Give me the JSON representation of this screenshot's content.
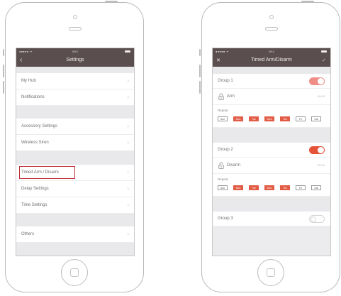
{
  "left_phone": {
    "status": {
      "signal": "●●●●● ᯤ",
      "time": "09:2"
    },
    "navbar": {
      "back_icon": "chevron-left",
      "title": "Settings"
    },
    "items": [
      {
        "label": "My Hub"
      },
      {
        "label": "Notifications"
      },
      {
        "label": "Accessory Settings"
      },
      {
        "label": "Wireless Siren"
      },
      {
        "label": "Timed Arm / Disarm",
        "highlighted": true
      },
      {
        "label": "Delay Settings"
      },
      {
        "label": "Time Settings"
      },
      {
        "label": "Others"
      }
    ],
    "chevron": "›",
    "highlight_color": "#c0303a"
  },
  "right_phone": {
    "status": {
      "signal": "●●●●● ᯤ",
      "time": "09:2"
    },
    "navbar": {
      "close_glyph": "✕",
      "title": "Timed Arm/Disarm",
      "confirm_glyph": "✓"
    },
    "groups": [
      {
        "name": "Group 1",
        "enabled": true,
        "mode": "Arm",
        "time": "00:00",
        "repeat_label": "Repeat",
        "days": [
          {
            "label": "Sun",
            "on": false
          },
          {
            "label": "Mon",
            "on": true
          },
          {
            "label": "Tue",
            "on": true
          },
          {
            "label": "Wed",
            "on": true
          },
          {
            "label": "Thu",
            "on": true
          },
          {
            "label": "Fri",
            "on": false
          },
          {
            "label": "Sat",
            "on": false
          }
        ]
      },
      {
        "name": "Group 2",
        "enabled": true,
        "mode": "Disarm",
        "time": "00:00",
        "repeat_label": "Repeat",
        "days": [
          {
            "label": "Sun",
            "on": false
          },
          {
            "label": "Mon",
            "on": true
          },
          {
            "label": "Tue",
            "on": true
          },
          {
            "label": "Wed",
            "on": true
          },
          {
            "label": "Thu",
            "on": true
          },
          {
            "label": "Fri",
            "on": false
          },
          {
            "label": "Sat",
            "on": false
          }
        ]
      },
      {
        "name": "Group 3",
        "enabled": false
      }
    ],
    "accent_color": "#e25b45"
  }
}
